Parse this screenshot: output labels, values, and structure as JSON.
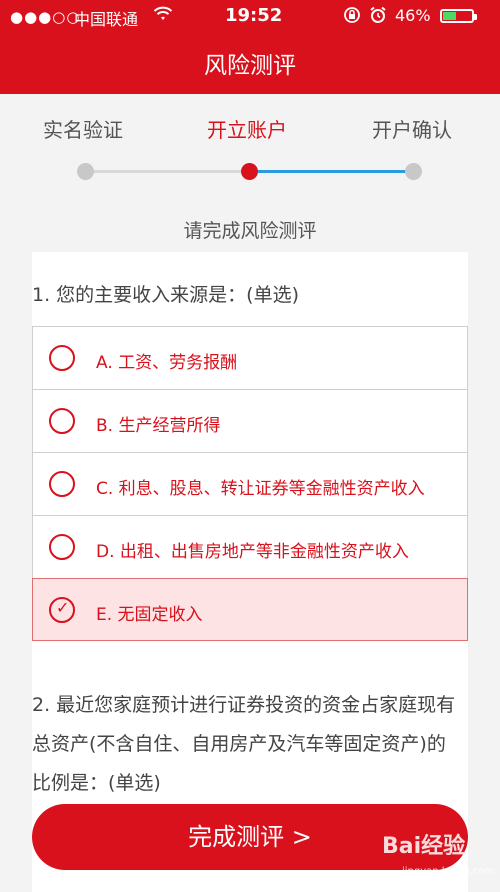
{
  "status_bar": {
    "signal": "●●●○○",
    "carrier": "中国联通",
    "wifi_icon": "wifi-icon",
    "time": "19:52",
    "battery_percent": "46%",
    "battery_level": 0.46
  },
  "header": {
    "title": "风险测评"
  },
  "steps": {
    "items": [
      {
        "label": "实名验证",
        "state": "done"
      },
      {
        "label": "开立账户",
        "state": "active"
      },
      {
        "label": "开户确认",
        "state": "pending"
      }
    ],
    "colors": {
      "active": "#d9111c",
      "inactive": "#c8c8c8",
      "progress": "#2a9be0"
    }
  },
  "subtitle": "请完成风险测评",
  "question1": {
    "title": "1. 您的主要收入来源是：(单选)",
    "options": [
      {
        "label": "A. 工资、劳务报酬",
        "selected": false
      },
      {
        "label": "B. 生产经营所得",
        "selected": false
      },
      {
        "label": "C. 利息、股息、转让证券等金融性资产收入",
        "selected": false
      },
      {
        "label": "D. 出租、出售房地产等非金融性资产收入",
        "selected": false
      },
      {
        "label": "E. 无固定收入",
        "selected": true
      }
    ]
  },
  "question2": {
    "title": "2. 最近您家庭预计进行证券投资的资金占家庭现有总资产(不含自住、自用房产及汽车等固定资产)的比例是：(单选)"
  },
  "bottom_button": {
    "label": "完成测评 >"
  },
  "watermark": {
    "text": "Bai经验",
    "sub": "jingyan.baidu.com"
  },
  "theme": {
    "brand": "#d9111c"
  }
}
